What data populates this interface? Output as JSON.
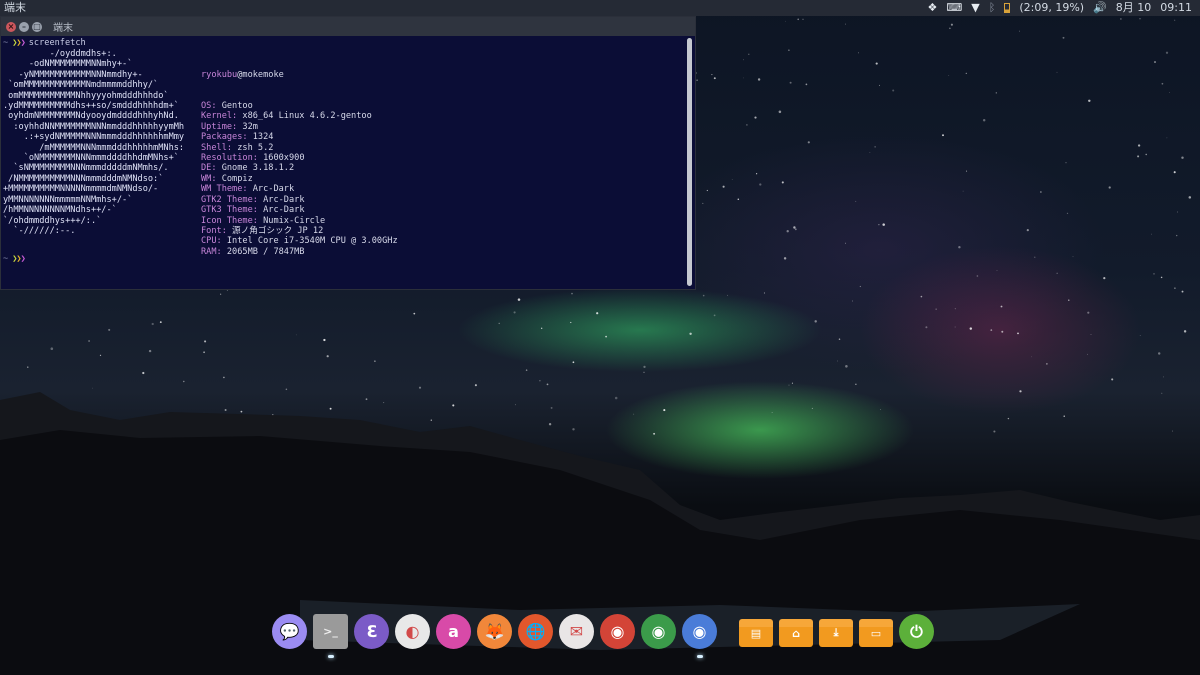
{
  "top_panel": {
    "window_title": "端末",
    "battery_text": "(2:09, 19%)",
    "date": "8月 10",
    "time": "09:11",
    "tray_icons": [
      "dropbox-icon",
      "keyboard-icon",
      "wifi-icon",
      "bluetooth-icon",
      "battery-icon",
      "volume-icon"
    ]
  },
  "terminal": {
    "title": "端末",
    "prompt_tilde": "~",
    "command": "screenfetch",
    "ascii_art": [
      "         -/oyddmdhs+:.",
      "     -odNMMMMMMMMNNmhy+-`",
      "   -yNMMMMMMMMMMMNNNmmdhy+-",
      " `omMMMMMMMMMMMMNmdmmmmddhhy/`",
      " omMMMMMMMMMMMNhhyyyohmdddhhhdo`",
      ".ydMMMMMMMMMMdhs++so/smdddhhhhdm+`",
      " oyhdmNMMMMMMMNdyooydmddddhhhyhNd.",
      "  :oyhhdNNMMMMMMMNNNmmdddhhhhhyymMh",
      "    .:+sydNMMMMMNNNmmmdddhhhhhhmMmy",
      "       /mMMMMMMNNNmmmdddhhhhhmMNhs:",
      "    `oNMMMMMMMNNNmmmddddhhdmMNhs+`",
      "  `sNMMMMMMMMNNNmmmdddddmNMmhs/.",
      " /NMMMMMMMMMMNNNmmmdddmNMNdso:`",
      "+MMMMMMMMMMNNNNNmmmmdmNMNdso/-",
      "yMMNNNNNNNmmmmmNNMmhs+/-`",
      "/hMMNNNNNNNNMNdhs++/-`",
      "`/ohdmmddhys+++/:.`",
      "  `-//////:--."
    ],
    "info": [
      {
        "key": "",
        "value": ""
      },
      {
        "key": "OS:",
        "value": " Gentoo"
      },
      {
        "key": "Kernel:",
        "value": " x86_64 Linux 4.6.2-gentoo"
      },
      {
        "key": "Uptime:",
        "value": " 32m"
      },
      {
        "key": "Packages:",
        "value": " 1324"
      },
      {
        "key": "Shell:",
        "value": " zsh 5.2"
      },
      {
        "key": "Resolution:",
        "value": " 1600x900"
      },
      {
        "key": "DE:",
        "value": " Gnome 3.18.1.2"
      },
      {
        "key": "WM:",
        "value": " Compiz"
      },
      {
        "key": "WM Theme:",
        "value": " Arc-Dark"
      },
      {
        "key": "GTK2 Theme:",
        "value": " Arc-Dark"
      },
      {
        "key": "GTK3 Theme:",
        "value": " Arc-Dark"
      },
      {
        "key": "Icon Theme:",
        "value": " Numix-Circle"
      },
      {
        "key": "Font:",
        "value": " 源ノ角ゴシック JP 12"
      },
      {
        "key": "CPU:",
        "value": " Intel Core i7-3540M CPU @ 3.00GHz"
      },
      {
        "key": "RAM:",
        "value": " 2065MB / 7847MB"
      }
    ],
    "user": "ryokubu",
    "at": "@",
    "host": "mokemoke"
  },
  "dock": {
    "items": [
      {
        "name": "chat-app-icon",
        "color": "#9b8cf2",
        "glyph": "💬",
        "running": false
      },
      {
        "name": "terminal-app-icon",
        "color": "#9a9a9a",
        "glyph": ">_",
        "running": true,
        "square": true
      },
      {
        "name": "emacs-icon",
        "color": "#7b5bc7",
        "glyph": "ℇ",
        "running": false
      },
      {
        "name": "settings-toggle-icon",
        "color": "#e8e8e8",
        "glyph": "◐",
        "running": false
      },
      {
        "name": "anki-icon",
        "color": "#d84aa8",
        "glyph": "a",
        "running": false
      },
      {
        "name": "gimp-icon",
        "color": "#f1873a",
        "glyph": "🦊",
        "running": false
      },
      {
        "name": "firefox-icon",
        "color": "#e2572c",
        "glyph": "🌐",
        "running": false
      },
      {
        "name": "mail-app-icon",
        "color": "#e9e6e6",
        "glyph": "✉",
        "running": false
      },
      {
        "name": "chrome-icon",
        "color": "#d34437",
        "glyph": "◉",
        "running": false
      },
      {
        "name": "chrome-alt-icon",
        "color": "#3b9b4a",
        "glyph": "◉",
        "running": false
      },
      {
        "name": "chromium-icon",
        "color": "#4a7cd8",
        "glyph": "◉",
        "running": true
      },
      {
        "name": "gap"
      },
      {
        "name": "documents-folder-icon",
        "folder": true,
        "glyph": "▤"
      },
      {
        "name": "home-folder-icon",
        "folder": true,
        "glyph": "⌂"
      },
      {
        "name": "downloads-folder-icon",
        "folder": true,
        "glyph": "⤓"
      },
      {
        "name": "desktop-folder-icon",
        "folder": true,
        "glyph": "▭"
      },
      {
        "name": "power-icon",
        "color": "#5cb03a",
        "glyph": "⏻",
        "running": false
      }
    ]
  }
}
